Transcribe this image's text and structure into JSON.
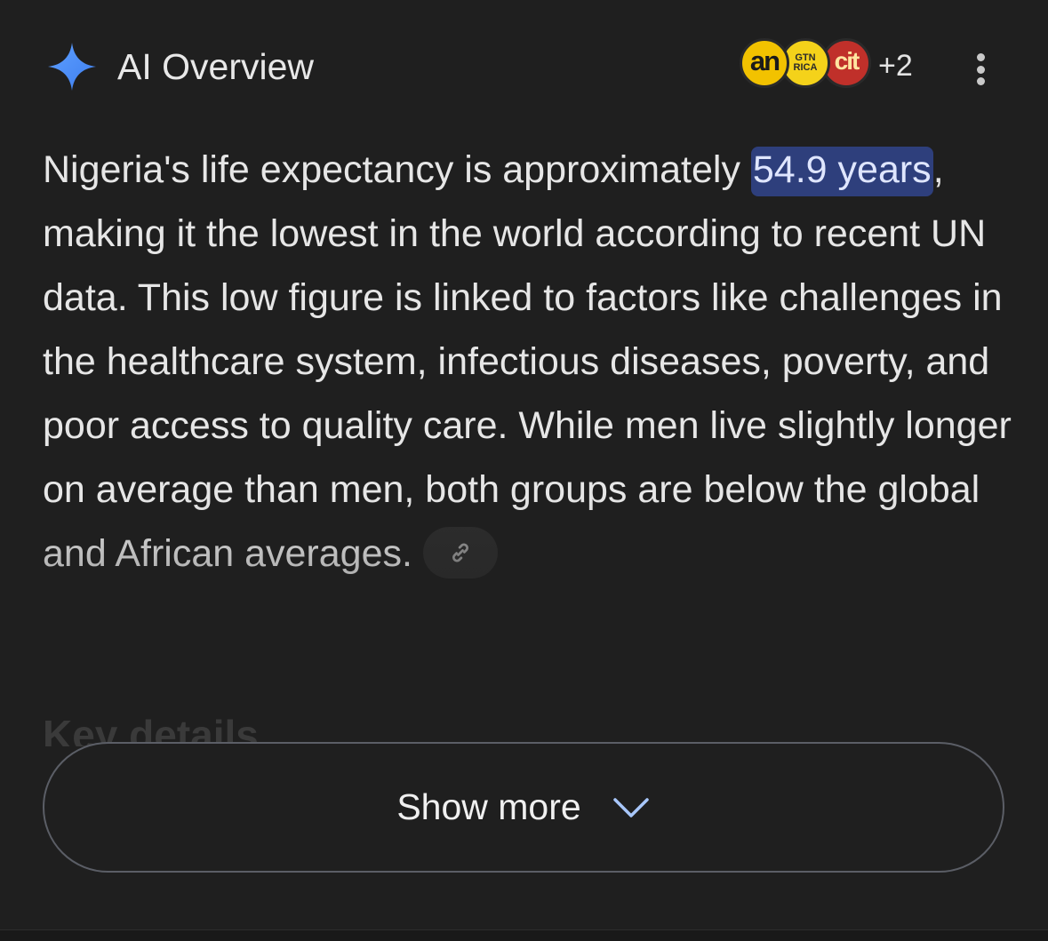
{
  "header": {
    "title": "AI Overview",
    "sources": [
      {
        "label": "an",
        "color": "#f2c200"
      },
      {
        "label": "GTN RICA",
        "color": "#f4d21a"
      },
      {
        "label": "cit",
        "color": "#c0302a"
      }
    ],
    "more_sources": "+2",
    "icons": {
      "spark": "gemini-spark-icon",
      "menu": "more-vert-icon"
    }
  },
  "overview": {
    "intro": "Nigeria's life expectancy is approximately ",
    "highlight": "54.9 years",
    "rest": ", making it the lowest in the world according to recent UN data. This low figure is linked to factors like challenges in the healthcare system, infectious diseases, poverty, and poor access to quality care. While men live slightly longer on average than men, both groups are below the global and African averages.",
    "link_icon": "link-icon"
  },
  "faded_heading": "Key details",
  "show_more": {
    "label": "Show more",
    "icon": "chevron-down-icon"
  },
  "colors": {
    "background": "#1f1f1f",
    "highlight": "#2e3f7c",
    "spark_blue": "#4a8ff7",
    "button_border": "#5b5e66"
  }
}
